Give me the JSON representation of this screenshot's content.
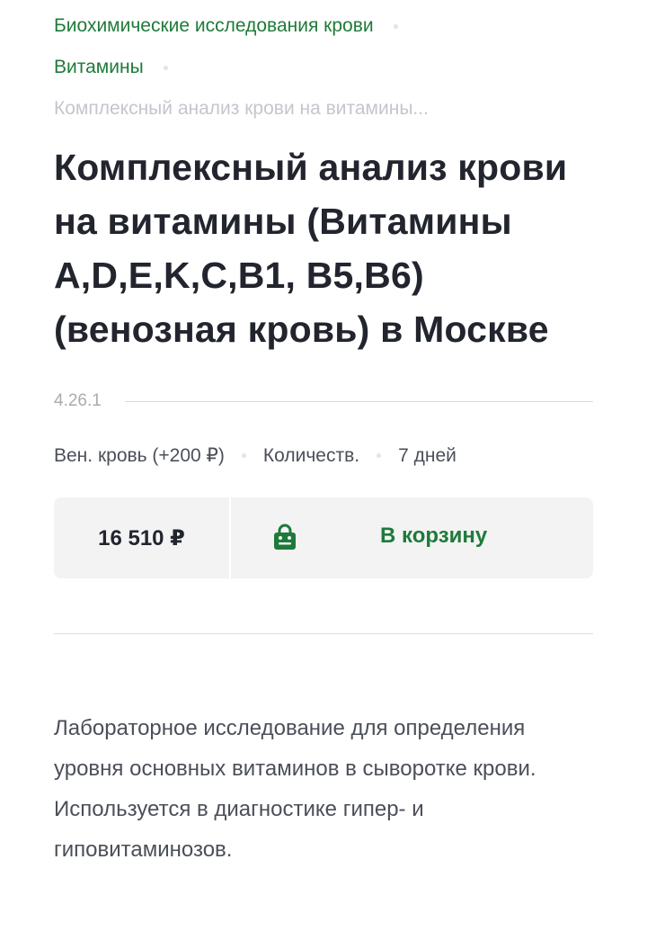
{
  "breadcrumb": {
    "items": [
      {
        "label": "Биохимические исследования крови"
      },
      {
        "label": "Витамины"
      }
    ],
    "current": "Комплексный анализ крови на витамины..."
  },
  "product": {
    "title": "Комплексный анализ крови на витамины (Витамины A,D,E,K,C,B1, B5,B6) (венозная кровь) в Москве",
    "code": "4.26.1",
    "biomaterial": "Вен. кровь (+200 ₽)",
    "method": "Количеств.",
    "duration": "7 дней",
    "price": "16 510 ₽",
    "cart_label": "В корзину",
    "description": "Лабораторное исследование для определения уровня основных витаминов в сыворотке крови. Используется в диагностике гипер- и гиповитаминозов."
  },
  "colors": {
    "accent": "#1f7a3a",
    "title": "#22252e",
    "muted": "#a8abb2",
    "box_bg": "#f3f3f4"
  },
  "icons": {
    "cart": "shopping-bag-icon",
    "separator": "dot-separator"
  }
}
